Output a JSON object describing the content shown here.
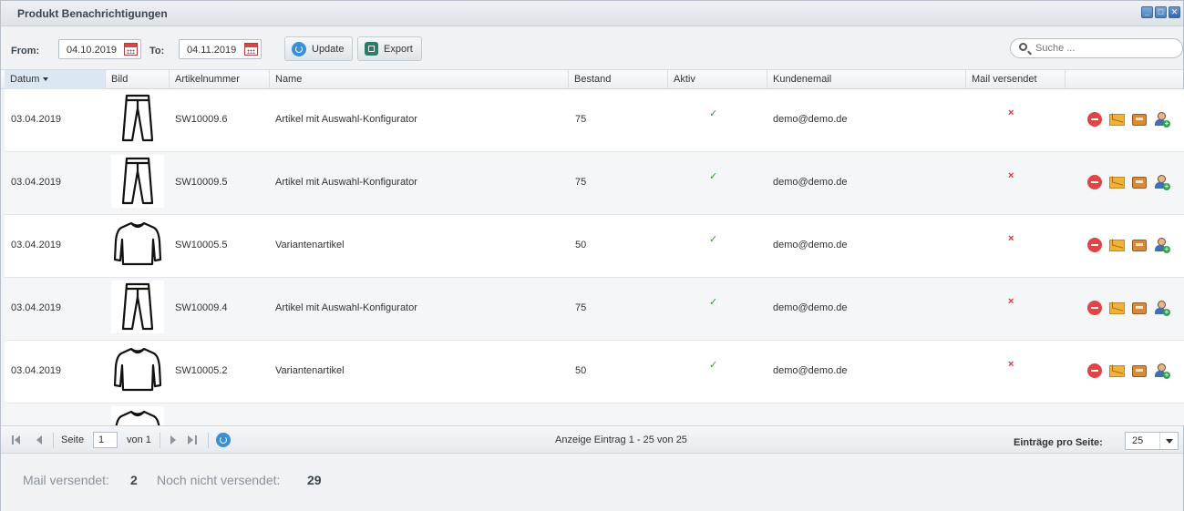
{
  "window": {
    "title": "Produkt Benachrichtigungen"
  },
  "toolbar": {
    "from_label": "From:",
    "from_value": "04.10.2019",
    "to_label": "To:",
    "to_value": "04.11.2019",
    "update_label": "Update",
    "export_label": "Export",
    "search_placeholder": "Suche ..."
  },
  "columns": [
    "Datum",
    "Bild",
    "Artikelnummer",
    "Name",
    "Bestand",
    "Aktiv",
    "Kundenemail",
    "Mail versendet"
  ],
  "sort": {
    "column": "Datum",
    "direction": "desc"
  },
  "rows": [
    {
      "datum": "03.04.2019",
      "image": "pants",
      "artikelnummer": "SW10009.6",
      "name": "Artikel mit Auswahl-Konfigurator",
      "bestand": "75",
      "aktiv": true,
      "email": "demo@demo.de",
      "mail_versendet": false
    },
    {
      "datum": "03.04.2019",
      "image": "pants",
      "artikelnummer": "SW10009.5",
      "name": "Artikel mit Auswahl-Konfigurator",
      "bestand": "75",
      "aktiv": true,
      "email": "demo@demo.de",
      "mail_versendet": false
    },
    {
      "datum": "03.04.2019",
      "image": "sweater",
      "artikelnummer": "SW10005.5",
      "name": "Variantenartikel",
      "bestand": "50",
      "aktiv": true,
      "email": "demo@demo.de",
      "mail_versendet": false
    },
    {
      "datum": "03.04.2019",
      "image": "pants",
      "artikelnummer": "SW10009.4",
      "name": "Artikel mit Auswahl-Konfigurator",
      "bestand": "75",
      "aktiv": true,
      "email": "demo@demo.de",
      "mail_versendet": false
    },
    {
      "datum": "03.04.2019",
      "image": "sweater",
      "artikelnummer": "SW10005.2",
      "name": "Variantenartikel",
      "bestand": "50",
      "aktiv": true,
      "email": "demo@demo.de",
      "mail_versendet": false
    },
    {
      "datum": "",
      "image": "sweater",
      "artikelnummer": "",
      "name": "",
      "bestand": "",
      "aktiv": null,
      "email": "",
      "mail_versendet": null
    }
  ],
  "row_action_icons": [
    "delete-icon",
    "send-mail-icon",
    "inbox-icon",
    "add-user-icon"
  ],
  "icons": {
    "check": "✓",
    "cross": "×"
  },
  "colors": {
    "check": "#2e9a2e",
    "cross": "#dd3333",
    "delete": "#e04444",
    "accent": "#3a8fd8"
  },
  "pager": {
    "page_label": "Seite",
    "page_value": "1",
    "of_label": "von 1",
    "info": "Anzeige Eintrag 1 - 25 von 25",
    "per_page_label": "Einträge pro Seite:",
    "per_page_value": "25"
  },
  "summary": {
    "sent_label": "Mail versendet:",
    "sent_value": "2",
    "not_sent_label": "Noch nicht versendet:",
    "not_sent_value": "29"
  }
}
